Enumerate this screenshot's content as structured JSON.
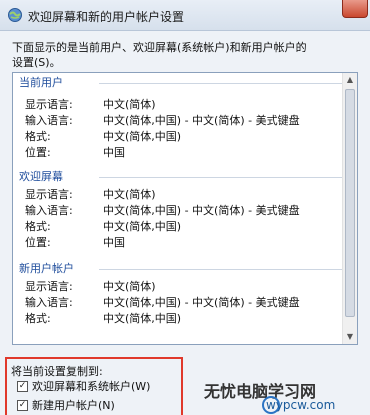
{
  "window": {
    "title": "欢迎屏幕和新的用户帐户设置",
    "icon": "settings-globe-icon"
  },
  "intro": {
    "line1": "下面显示的是当前用户、欢迎屏幕(系统帐户)和新用户帐户的",
    "line2": "设置(S)。"
  },
  "groups": [
    {
      "title": "当前用户",
      "rows": [
        {
          "label": "显示语言:",
          "value": "中文(简体)"
        },
        {
          "label": "输入语言:",
          "value": "中文(简体,中国) - 中文(简体) - 美式键盘"
        },
        {
          "label": "格式:",
          "value": "中文(简体,中国)"
        },
        {
          "label": "位置:",
          "value": "中国"
        }
      ]
    },
    {
      "title": "欢迎屏幕",
      "rows": [
        {
          "label": "显示语言:",
          "value": "中文(简体)"
        },
        {
          "label": "输入语言:",
          "value": "中文(简体,中国) - 中文(简体) - 美式键盘"
        },
        {
          "label": "格式:",
          "value": "中文(简体,中国)"
        },
        {
          "label": "位置:",
          "value": "中国"
        }
      ]
    },
    {
      "title": "新用户帐户",
      "rows": [
        {
          "label": "显示语言:",
          "value": "中文(简体)"
        },
        {
          "label": "输入语言:",
          "value": "中文(简体,中国) - 中文(简体) - 美式键盘"
        },
        {
          "label": "格式:",
          "value": "中文(简体,中国)"
        }
      ]
    }
  ],
  "copy": {
    "title": "将当前设置复制到:",
    "options": [
      {
        "label": "欢迎屏幕和系统帐户(W)",
        "checked": true
      },
      {
        "label": "新建用户帐户(N)",
        "checked": true
      }
    ]
  },
  "watermark": {
    "line1": "无忧电脑学习网",
    "line2": "wypcw.com"
  },
  "colors": {
    "group_title": "#1f4d9c",
    "highlight_border": "#e0392b",
    "close_button": "#c9482f"
  }
}
